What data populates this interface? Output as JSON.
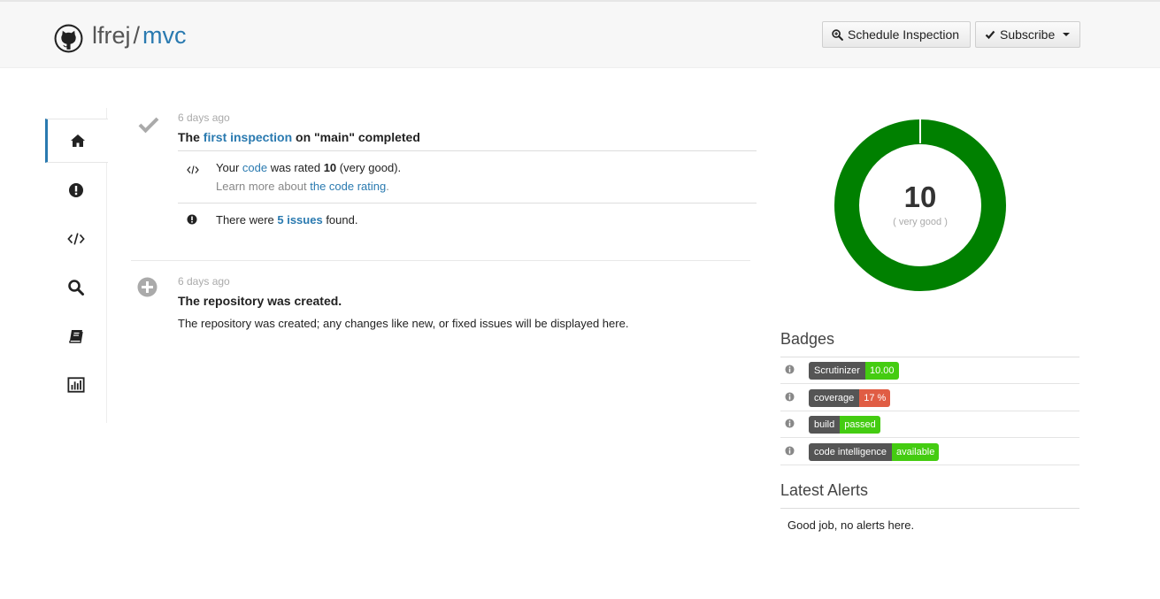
{
  "header": {
    "owner": "lfrej",
    "separator": "/",
    "repo": "mvc",
    "schedule_label": "Schedule Inspection",
    "subscribe_label": "Subscribe"
  },
  "sidebar": {
    "items": [
      {
        "icon": "home-icon",
        "active": true
      },
      {
        "icon": "issues-icon"
      },
      {
        "icon": "code-icon"
      },
      {
        "icon": "search-icon"
      },
      {
        "icon": "book-icon"
      },
      {
        "icon": "statistics-icon"
      }
    ]
  },
  "feed": {
    "event1": {
      "time": "6 days ago",
      "title_prefix": "The ",
      "title_link": "first inspection",
      "title_suffix": " on \"main\" completed",
      "rating": {
        "prefix": "Your ",
        "link": "code",
        "middle": " was rated ",
        "value": "10",
        "suffix": " (very good).",
        "learn_prefix": "Learn more about ",
        "learn_link": "the code rating",
        "learn_suffix": "."
      },
      "issues": {
        "prefix": "There were ",
        "link": "5 issues",
        "suffix": " found."
      }
    },
    "event2": {
      "time": "6 days ago",
      "title": "The repository was created.",
      "body": "The repository was created; any changes like new, or fixed issues will be displayed here."
    }
  },
  "rating": {
    "value": "10",
    "label": "( very good )",
    "fraction": 1.0,
    "color": "#008000"
  },
  "badges": {
    "title": "Badges",
    "items": [
      {
        "left": "Scrutinizer",
        "right": "10.00",
        "color": "#4c1"
      },
      {
        "left": "coverage",
        "right": "17 %",
        "color": "#e05d44"
      },
      {
        "left": "build",
        "right": "passed",
        "color": "#4c1"
      },
      {
        "left": "code intelligence",
        "right": "available",
        "color": "#4c1"
      }
    ]
  },
  "alerts": {
    "title": "Latest Alerts",
    "text": "Good job, no alerts here."
  }
}
